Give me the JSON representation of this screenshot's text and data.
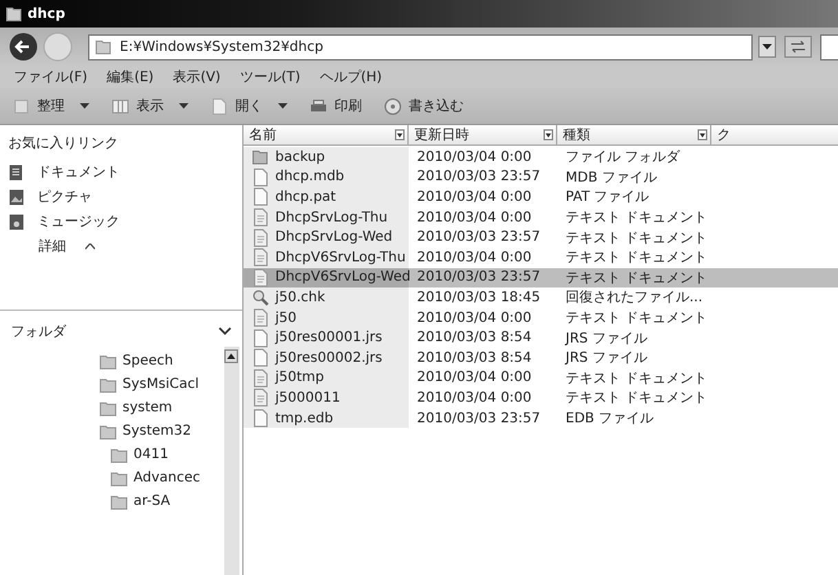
{
  "window": {
    "title": "dhcp"
  },
  "address": {
    "value": "E:¥Windows¥System32¥dhcp"
  },
  "menu": [
    "ファイル(F)",
    "編集(E)",
    "表示(V)",
    "ツール(T)",
    "ヘルプ(H)"
  ],
  "toolbar": [
    {
      "label": "整理",
      "kind": "organize",
      "dropdown": true
    },
    {
      "label": "表示",
      "kind": "views",
      "dropdown": true
    },
    {
      "label": "開く",
      "kind": "open",
      "dropdown": true
    },
    {
      "label": "印刷",
      "kind": "print",
      "dropdown": false
    },
    {
      "label": "書き込む",
      "kind": "burn",
      "dropdown": false
    }
  ],
  "favorites": {
    "title": "お気に入りリンク",
    "items": [
      {
        "label": "ドキュメント",
        "kind": "documents"
      },
      {
        "label": "ピクチャ",
        "kind": "pictures"
      },
      {
        "label": "ミュージック",
        "kind": "music"
      }
    ],
    "more": "詳細"
  },
  "folders": {
    "title": "フォルダ",
    "items": [
      {
        "label": "Speech"
      },
      {
        "label": "SysMsiCacl"
      },
      {
        "label": "system"
      },
      {
        "label": "System32",
        "children": [
          {
            "label": "0411"
          },
          {
            "label": "Advancec"
          },
          {
            "label": "ar-SA"
          }
        ]
      }
    ]
  },
  "table": {
    "columns": [
      "名前",
      "更新日時",
      "種類",
      "ク"
    ],
    "rows": [
      {
        "kind": "folder",
        "name": "backup",
        "date": "2010/03/04 0:00",
        "type": "ファイル フォルダ",
        "selected": false
      },
      {
        "kind": "file",
        "name": "dhcp.mdb",
        "date": "2010/03/03 23:57",
        "type": "MDB ファイル",
        "selected": false
      },
      {
        "kind": "file",
        "name": "dhcp.pat",
        "date": "2010/03/04 0:00",
        "type": "PAT ファイル",
        "selected": false
      },
      {
        "kind": "text",
        "name": "DhcpSrvLog-Thu",
        "date": "2010/03/04 0:00",
        "type": "テキスト ドキュメント",
        "selected": false
      },
      {
        "kind": "text",
        "name": "DhcpSrvLog-Wed",
        "date": "2010/03/03 23:57",
        "type": "テキスト ドキュメント",
        "selected": false
      },
      {
        "kind": "text",
        "name": "DhcpV6SrvLog-Thu",
        "date": "2010/03/04 0:00",
        "type": "テキスト ドキュメント",
        "selected": false
      },
      {
        "kind": "text",
        "name": "DhcpV6SrvLog-Wed",
        "date": "2010/03/03 23:57",
        "type": "テキスト ドキュメント",
        "selected": true
      },
      {
        "kind": "chk",
        "name": "j50.chk",
        "date": "2010/03/03 18:45",
        "type": "回復されたファイル...",
        "selected": false
      },
      {
        "kind": "text",
        "name": "j50",
        "date": "2010/03/04 0:00",
        "type": "テキスト ドキュメント",
        "selected": false
      },
      {
        "kind": "file",
        "name": "j50res00001.jrs",
        "date": "2010/03/03 8:54",
        "type": "JRS ファイル",
        "selected": false
      },
      {
        "kind": "file",
        "name": "j50res00002.jrs",
        "date": "2010/03/03 8:54",
        "type": "JRS ファイル",
        "selected": false
      },
      {
        "kind": "text",
        "name": "j50tmp",
        "date": "2010/03/04 0:00",
        "type": "テキスト ドキュメント",
        "selected": false
      },
      {
        "kind": "text",
        "name": "j5000011",
        "date": "2010/03/04 0:00",
        "type": "テキスト ドキュメント",
        "selected": false
      },
      {
        "kind": "file",
        "name": "tmp.edb",
        "date": "2010/03/03 23:57",
        "type": "EDB ファイル",
        "selected": false
      }
    ]
  }
}
